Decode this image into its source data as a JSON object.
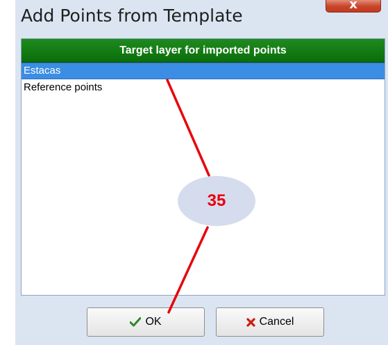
{
  "dialog": {
    "title": "Add Points from Template",
    "close_label": "x"
  },
  "list": {
    "header": "Target layer for imported points",
    "items": [
      {
        "label": "Estacas",
        "selected": true
      },
      {
        "label": "Reference points",
        "selected": false
      }
    ]
  },
  "buttons": {
    "ok_label": "OK",
    "ok_icon": "checkmark-icon",
    "cancel_label": "Cancel",
    "cancel_icon": "x-mark-icon"
  },
  "annotation": {
    "callout_number": "35",
    "color": "#e8000a"
  },
  "colors": {
    "header_green": "#0a6e0a",
    "selection_blue": "#3b8ee4",
    "dialog_background": "#dbe5f1"
  }
}
